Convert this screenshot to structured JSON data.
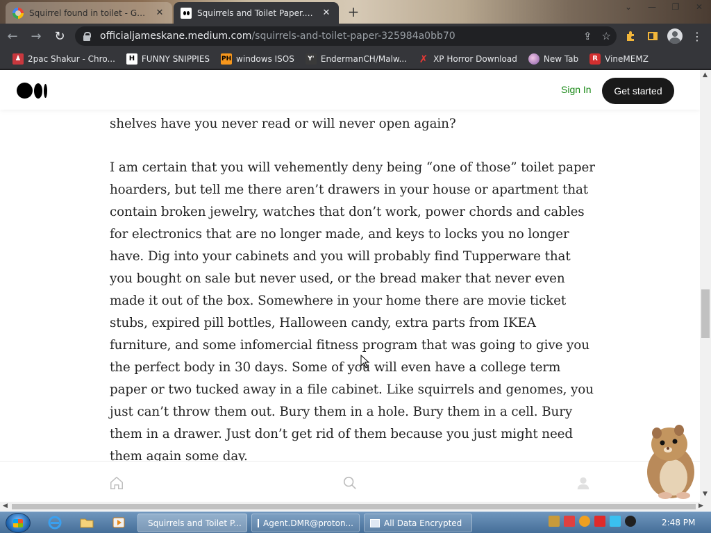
{
  "browser": {
    "tabs": [
      {
        "title": "Squirrel found in toilet - Google",
        "active": false
      },
      {
        "title": "Squirrels and Toilet Paper. There",
        "active": true
      }
    ],
    "url_domain": "officialjameskane.medium.com",
    "url_path": "/squirrels-and-toilet-paper-325984a0bb70",
    "bookmarks": [
      {
        "label": "2pac Shakur - Chro...",
        "icon": "bookmark-icon"
      },
      {
        "label": "FUNNY SNIPPIES",
        "icon": "h-icon"
      },
      {
        "label": "windows ISOS",
        "icon": "ph-icon"
      },
      {
        "label": "EndermanCH/Malw...",
        "icon": "yp-icon"
      },
      {
        "label": "XP Horror Download",
        "icon": "x-icon"
      },
      {
        "label": "New Tab",
        "icon": "globe-icon"
      },
      {
        "label": "VineMEMZ",
        "icon": "r-icon"
      }
    ]
  },
  "site": {
    "signin_label": "Sign In",
    "getstarted_label": "Get started"
  },
  "article": {
    "paragraphs": [
      "shelves have you never read or will never open again?",
      "I am certain that you will vehemently deny being “one of those” toilet paper hoarders, but tell me there aren’t drawers in your house or apartment that contain broken jewelry, watches that don’t work, power chords and cables for electronics that are no longer made, and keys to locks you no longer have. Dig into your cabinets and you will probably find Tupperware that you bought on sale but never used, or the bread maker that never even made it out of the box. Somewhere in your home there are movie ticket stubs, expired pill bottles, Halloween candy, extra parts from IKEA furniture, and some infomercial fitness program that was going to give you the perfect body in 30 days. Some of you will even have a college term paper or two tucked away in a file cabinet. Like squirrels and genomes, you just can’t throw them out. Bury them in a hole. Bury them in a cell. Bury them in a drawer. Just don’t get rid of them because you just might need them again some day."
    ]
  },
  "taskbar": {
    "tasks": [
      {
        "label": "Squirrels and Toilet P..."
      },
      {
        "label": "Agent.DMR@proton..."
      },
      {
        "label": "All Data Encrypted"
      }
    ],
    "clock": "2:48 PM"
  },
  "colors": {
    "medium_green": "#1a8917",
    "button_dark": "#191919",
    "text": "#242424"
  }
}
